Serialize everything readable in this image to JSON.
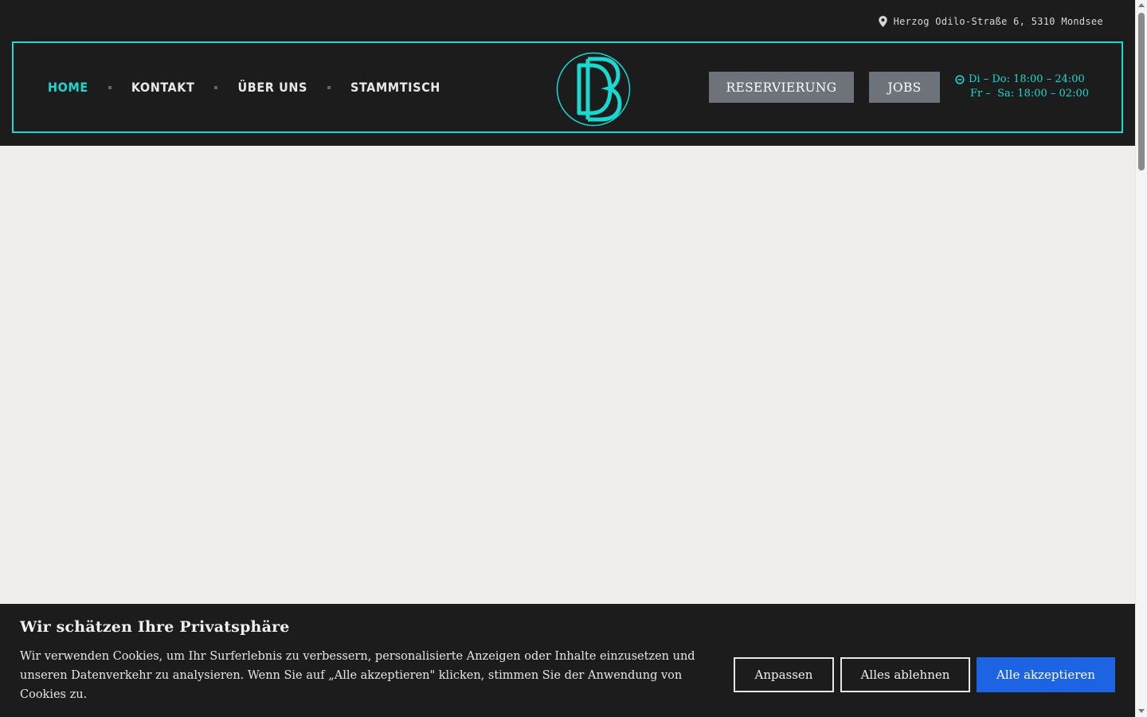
{
  "header": {
    "address": "Herzog Odilo-Straße 6, 5310 Mondsee",
    "address_icon": "location-pin-icon",
    "nav": [
      {
        "label": "HOME",
        "active": true
      },
      {
        "label": "KONTAKT",
        "active": false
      },
      {
        "label": "ÜBER UNS",
        "active": false
      },
      {
        "label": "STAMMTISCH",
        "active": false
      }
    ],
    "logo_icon": "db-monogram-logo",
    "buttons": {
      "reservation": "RESERVIERUNG",
      "jobs": "JOBS"
    },
    "hours_icon": "clock-icon",
    "hours": [
      "Di – Do: 18:00 – 24:00",
      "Fr –  Sa: 18:00 – 02:00"
    ]
  },
  "cookie_banner": {
    "title": "Wir schätzen Ihre Privatsphäre",
    "text": "Wir verwenden Cookies, um Ihr Surferlebnis zu verbessern, personalisierte Anzeigen oder Inhalte einzusetzen und unseren Datenverkehr zu analysieren. Wenn Sie auf „Alle akzeptieren\" klicken, stimmen Sie der Anwendung von Cookies zu.",
    "buttons": {
      "customize": "Anpassen",
      "reject": "Alles ablehnen",
      "accept": "Alle akzeptieren"
    }
  },
  "colors": {
    "accent": "#19d8d0",
    "header_bg": "#1c1c1d",
    "button_gray": "#6d727b",
    "accept_blue": "#1c64e3",
    "page_bg": "#efeeea"
  }
}
